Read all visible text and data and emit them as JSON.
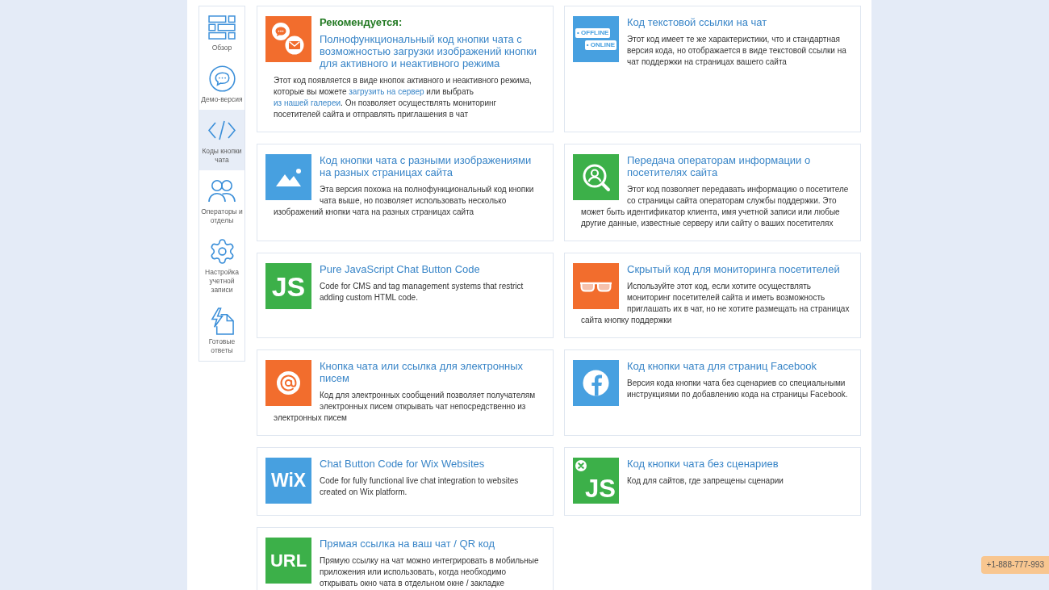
{
  "sidebar": {
    "items": [
      {
        "kind": "overview",
        "label": "Обзор",
        "selected": false
      },
      {
        "kind": "demo",
        "label": "Демо-версия",
        "selected": false
      },
      {
        "kind": "code",
        "label": "Коды кнопки чата",
        "selected": true
      },
      {
        "kind": "operators",
        "label": "Операторы и отделы",
        "selected": false
      },
      {
        "kind": "settings",
        "label": "Настройка учетной записи",
        "selected": false
      },
      {
        "kind": "answers",
        "label": "Готовые ответы",
        "selected": false
      }
    ]
  },
  "cards": [
    {
      "kind": "chat",
      "color": "#f26d2d",
      "recommended": "Рекомендуется:",
      "title": "Полнофункциональный код кнопки чата с возможностью загрузки изображений кнопки для активного и неактивного режима",
      "description": [
        {
          "kind": "text",
          "text": "Этот код появляется в виде кнопок активного и неактивного режима, которые вы можете "
        },
        {
          "kind": "link",
          "text": "загрузить на сервер"
        },
        {
          "kind": "text",
          "text": " или выбрать "
        },
        {
          "kind": "link",
          "text": "из нашей галереи"
        },
        {
          "kind": "text",
          "text": ". Он позволяет осуществлять мониторинг посетителей сайта и отправлять приглашения в чат"
        }
      ]
    },
    {
      "kind": "textlink",
      "color": "#47a0e0",
      "icon_labels": [
        "• OFFLINE",
        "• ONLINE"
      ],
      "title": "Код текстовой ссылки на чат",
      "description": [
        {
          "kind": "text",
          "text": "Этот код имеет те же характеристики, что и стандартная версия кода, но отображается в виде текстовой ссылки на чат поддержки на страницах вашего сайта"
        }
      ]
    },
    {
      "kind": "images",
      "color": "#47a0e0",
      "title": "Код кнопки чата с разными изображениями на разных страницах сайта",
      "description": [
        {
          "kind": "text",
          "text": "Эта версия похожа на полнофункциональный код кнопки чата выше, но позволяет использовать несколько изображений кнопки чата на разных страницах сайта"
        }
      ]
    },
    {
      "kind": "visitors",
      "color": "#3cb049",
      "title": "Передача операторам информации о посетителях сайта",
      "description": [
        {
          "kind": "text",
          "text": "Этот код позволяет передавать информацию о посетителе со страницы сайта операторам службы поддержки. Это может быть идентификатор клиента, имя учетной записи или любые другие данные, известные серверу или сайту о ваших посетителях"
        }
      ]
    },
    {
      "kind": "js",
      "color": "#3cb049",
      "icon_text": "JS",
      "title": "Pure JavaScript Chat Button Code",
      "description": [
        {
          "kind": "text",
          "text": "Code for CMS and tag management systems that restrict adding custom HTML code."
        }
      ]
    },
    {
      "kind": "hidden",
      "color": "#f26d2d",
      "title": "Скрытый код для мониторинга посетителей",
      "description": [
        {
          "kind": "text",
          "text": "Используйте этот код, если хотите осуществлять мониторинг посетителей сайта и иметь возможность приглашать их в чат, но не хотите размещать на страницах сайта кнопку поддержки"
        }
      ]
    },
    {
      "kind": "email",
      "color": "#f26d2d",
      "title": "Кнопка чата или ссылка для электронных писем",
      "description": [
        {
          "kind": "text",
          "text": "Код для электронных сообщений позволяет получателям электронных писем открывать чат непосредственно из электронных писем"
        }
      ]
    },
    {
      "kind": "facebook",
      "color": "#47a0e0",
      "title": "Код кнопки чата для страниц Facebook",
      "description": [
        {
          "kind": "text",
          "text": "Версия кода кнопки чата без сценариев со специальными инструкциями по добавлению кода на страницы Facebook."
        }
      ]
    },
    {
      "kind": "wix",
      "color": "#47a0e0",
      "icon_text": "WiX",
      "title": "Chat Button Code for Wix Websites",
      "description": [
        {
          "kind": "text",
          "text": "Code for fully functional live chat integration to websites created on Wix platform."
        }
      ]
    },
    {
      "kind": "nojs",
      "color": "#3cb049",
      "icon_text": "JS",
      "title": "Код кнопки чата без сценариев",
      "description": [
        {
          "kind": "text",
          "text": "Код для сайтов, где запрещены сценарии"
        }
      ]
    },
    {
      "kind": "url",
      "color": "#3cb049",
      "icon_text": "URL",
      "title": "Прямая ссылка на ваш чат / QR код",
      "description": [
        {
          "kind": "text",
          "text": "Прямую ссылку на чат можно интегрировать в мобильные приложения или использовать, когда необходимо открывать окно чата в отдельном окне / закладке"
        }
      ]
    }
  ],
  "contact_phone": "+1-888-777-993"
}
